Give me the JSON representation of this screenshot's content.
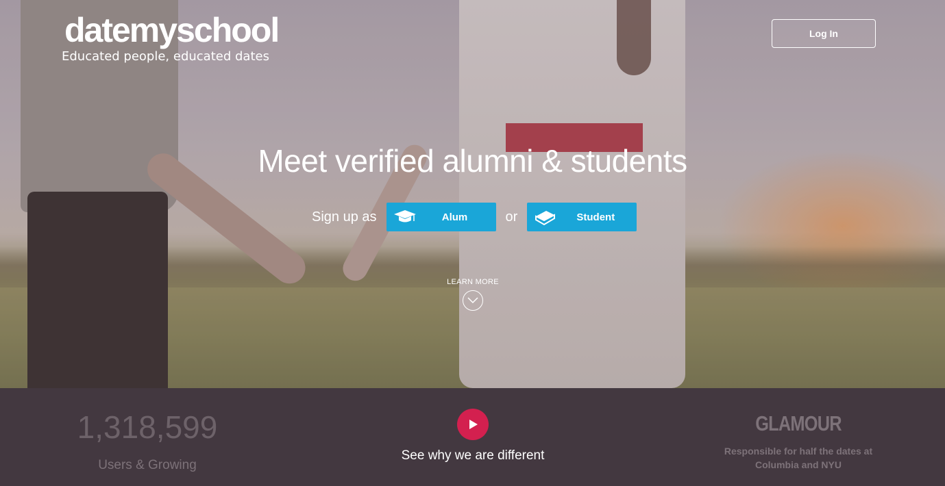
{
  "header": {
    "logo_name": "datemyschool",
    "logo_tagline": "Educated people, educated dates",
    "login_label": "Log In"
  },
  "hero": {
    "headline": "Meet verified alumni & students",
    "signup_prefix": "Sign up as",
    "alum_label": "Alum",
    "or_label": "or",
    "student_label": "Student",
    "learn_more": "LEARN MORE"
  },
  "band": {
    "user_count": "1,318,599",
    "user_count_label": "Users & Growing",
    "video_label": "See why we are different",
    "press_brand": "GLAMOUR",
    "press_quote_line1": "Responsible for half the dates at",
    "press_quote_line2": "Columbia and NYU"
  },
  "icons": {
    "alum": "graduation-cap-icon",
    "student": "book-icon",
    "learn_more": "chevron-down-circle-icon",
    "video": "play-icon"
  },
  "colors": {
    "accent_blue": "#1aa6d8",
    "play_red": "#d3204f",
    "band_bg": "#433840"
  }
}
